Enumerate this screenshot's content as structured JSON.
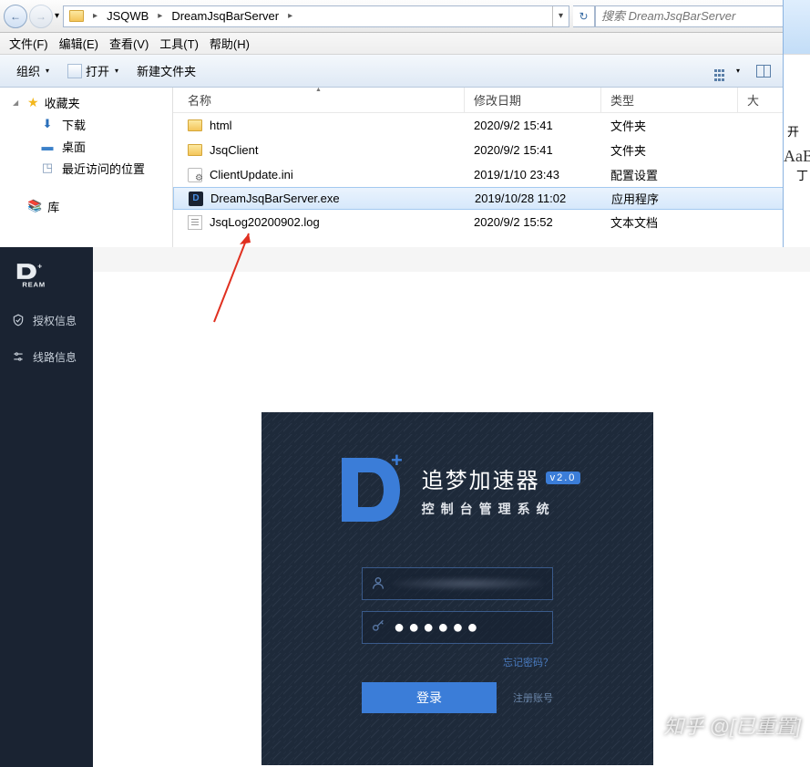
{
  "nav": {
    "path_segments": [
      "JSQWB",
      "DreamJsqBarServer"
    ],
    "search_placeholder": "搜索 DreamJsqBarServer"
  },
  "menu": {
    "items": [
      {
        "label": "文件(F)"
      },
      {
        "label": "编辑(E)"
      },
      {
        "label": "查看(V)"
      },
      {
        "label": "工具(T)"
      },
      {
        "label": "帮助(H)"
      }
    ]
  },
  "toolbar": {
    "organize": "组织",
    "open": "打开",
    "new_folder": "新建文件夹"
  },
  "nav_pane": {
    "favorites": "收藏夹",
    "downloads": "下载",
    "desktop": "桌面",
    "recent": "最近访问的位置",
    "libraries": "库"
  },
  "columns": {
    "name": "名称",
    "date": "修改日期",
    "type": "类型",
    "size": "大"
  },
  "files": [
    {
      "name": "html",
      "date": "2020/9/2 15:41",
      "type": "文件夹",
      "icon": "folder"
    },
    {
      "name": "JsqClient",
      "date": "2020/9/2 15:41",
      "type": "文件夹",
      "icon": "folder"
    },
    {
      "name": "ClientUpdate.ini",
      "date": "2019/1/10 23:43",
      "type": "配置设置",
      "icon": "ini"
    },
    {
      "name": "DreamJsqBarServer.exe",
      "date": "2019/10/28 11:02",
      "type": "应用程序",
      "icon": "exe",
      "selected": true
    },
    {
      "name": "JsqLog20200902.log",
      "date": "2020/9/2 15:52",
      "type": "文本文档",
      "icon": "log"
    }
  ],
  "right_edge": {
    "open": "开",
    "aab": "AaB"
  },
  "dream_sidebar": {
    "logo_text": "D⁺REAM",
    "items": [
      {
        "label": "授权信息"
      },
      {
        "label": "线路信息"
      }
    ]
  },
  "login": {
    "title": "追梦加速器",
    "version": "v2.0",
    "subtitle": "控制台管理系统",
    "password_mask": "●●●●●●",
    "forgot": "忘记密码？",
    "login_btn": "登录",
    "register": "注册账号"
  },
  "watermark": "知乎 @[已重置]"
}
